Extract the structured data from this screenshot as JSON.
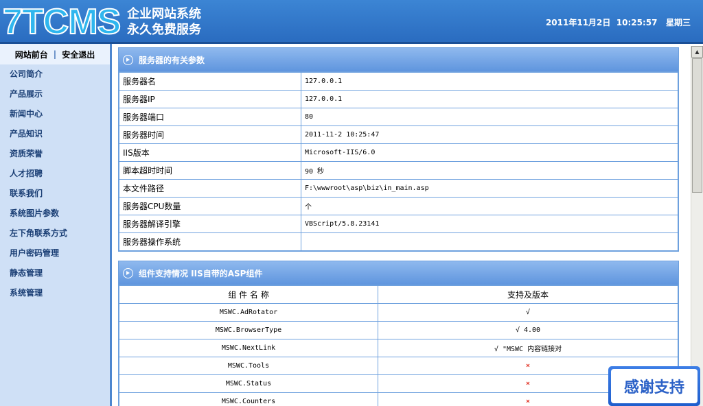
{
  "header": {
    "logo_text": "7TCMS",
    "slogan_line1": "企业网站系统",
    "slogan_line2": "永久免费服务",
    "datetime": "2011年11月2日  10:25:57   星期三"
  },
  "sidebar": {
    "top_links": {
      "front": "网站前台",
      "separator": "|",
      "logout": "安全退出"
    },
    "items": [
      {
        "label": "公司简介"
      },
      {
        "label": "产品展示"
      },
      {
        "label": "新闻中心"
      },
      {
        "label": "产品知识"
      },
      {
        "label": "资质荣誉"
      },
      {
        "label": "人才招聘"
      },
      {
        "label": "联系我们"
      },
      {
        "label": "系统图片参数"
      },
      {
        "label": "左下角联系方式"
      },
      {
        "label": "用户密码管理"
      },
      {
        "label": "静态管理"
      },
      {
        "label": "系统管理"
      }
    ]
  },
  "server_panel": {
    "title": "服务器的有关参数",
    "rows": [
      {
        "label": "服务器名",
        "value": "127.0.0.1"
      },
      {
        "label": "服务器IP",
        "value": "127.0.0.1"
      },
      {
        "label": "服务器端口",
        "value": "80"
      },
      {
        "label": "服务器时间",
        "value": "2011-11-2 10:25:47"
      },
      {
        "label": "IIS版本",
        "value": "Microsoft-IIS/6.0"
      },
      {
        "label": "脚本超时时间",
        "value": "90 秒"
      },
      {
        "label": "本文件路径",
        "value": "F:\\wwwroot\\asp\\biz\\in_main.asp"
      },
      {
        "label": "服务器CPU数量",
        "value": " 个"
      },
      {
        "label": "服务器解译引擎",
        "value": "VBScript/5.8.23141"
      },
      {
        "label": "服务器操作系统",
        "value": ""
      }
    ]
  },
  "component_panel": {
    "title": "组件支持情况 IIS自带的ASP组件",
    "col_name": "组 件 名 称",
    "col_version": "支持及版本",
    "rows": [
      {
        "name": "MSWC.AdRotator",
        "support": "√"
      },
      {
        "name": "MSWC.BrowserType",
        "support": "√ 4.00"
      },
      {
        "name": "MSWC.NextLink",
        "support": "√ \"MSWC 内容链接对"
      },
      {
        "name": "MSWC.Tools",
        "support": "×"
      },
      {
        "name": "MSWC.Status",
        "support": "×"
      },
      {
        "name": "MSWC.Counters",
        "support": "×"
      }
    ]
  },
  "badge": {
    "text": "感谢支持"
  },
  "colors": {
    "header": "#2f74cc",
    "sidebar": "#cfe0f6",
    "panel_head": "#6f9fe2",
    "no_support": "#e23b2e"
  }
}
